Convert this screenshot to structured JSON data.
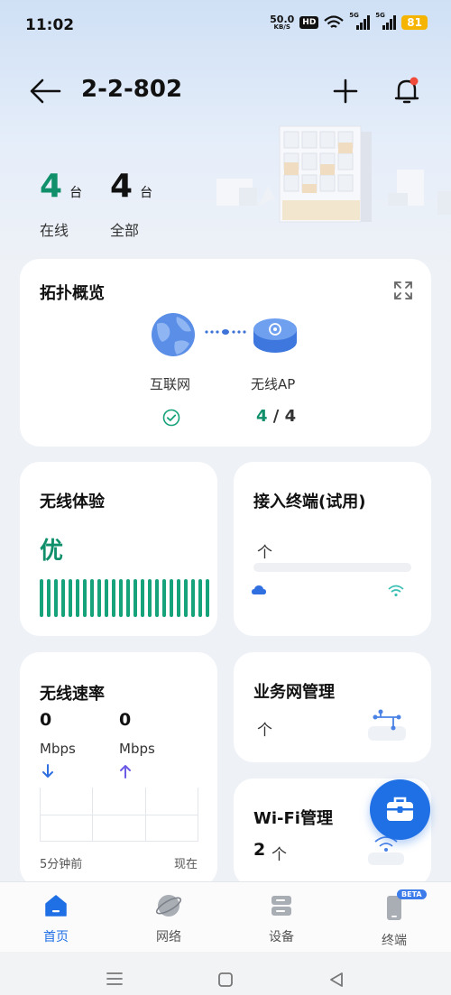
{
  "status_bar": {
    "time": "11:02",
    "net_speed_value": "50.0",
    "net_speed_unit": "KB/S",
    "hd_label": "HD",
    "sim1_label": "5G",
    "sim2_label": "5G",
    "battery": "81"
  },
  "header": {
    "title": "2-2-802"
  },
  "summary": {
    "online_count": "4",
    "online_unit": "台",
    "online_label": "在线",
    "all_count": "4",
    "all_unit": "台",
    "all_label": "全部"
  },
  "topology": {
    "title": "拓扑概览",
    "internet_label": "互联网",
    "ap_label": "无线AP",
    "ap_online": "4",
    "ap_separator": " / ",
    "ap_total": "4"
  },
  "wireless_experience": {
    "title": "无线体验",
    "rating": "优",
    "bar_count": 24
  },
  "terminals": {
    "title": "接入终端(试用)",
    "unit": "个"
  },
  "wireless_speed": {
    "title": "无线速率",
    "down_value": "0",
    "down_unit": "Mbps",
    "up_value": "0",
    "up_unit": "Mbps",
    "x_start": "5分钟前",
    "x_end": "现在"
  },
  "business_network": {
    "title": "业务网管理",
    "unit": "个"
  },
  "wifi_management": {
    "title": "Wi-Fi管理",
    "count": "2",
    "unit": "个"
  },
  "bottom_nav": {
    "home": "首页",
    "network": "网络",
    "devices": "设备",
    "terminals": "终端",
    "beta": "BETA"
  },
  "colors": {
    "accent": "#1f6fe5",
    "good": "#0f8f6a"
  }
}
